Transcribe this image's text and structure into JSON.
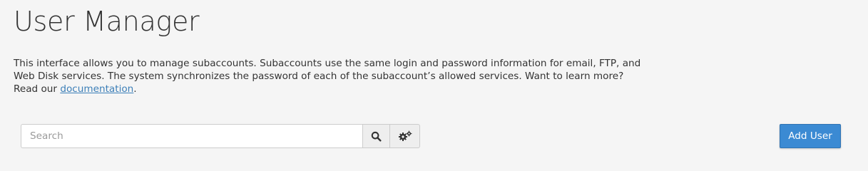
{
  "header": {
    "title": "User Manager"
  },
  "intro": {
    "text_before_link": "This interface allows you to manage subaccounts. Subaccounts use the same login and password information for email, FTP, and Web Disk services. The system synchronizes the password of each of the subaccount’s allowed services. Want to learn more? Read our ",
    "link_label": "documentation",
    "text_after_link": "."
  },
  "search": {
    "placeholder": "Search",
    "value": "",
    "search_icon": "search-icon",
    "settings_icon": "gears-icon"
  },
  "toolbar": {
    "add_user_label": "Add User"
  },
  "colors": {
    "background": "#f5f5f5",
    "primary_button": "#3b8ad3",
    "link": "#3c7fb8"
  }
}
